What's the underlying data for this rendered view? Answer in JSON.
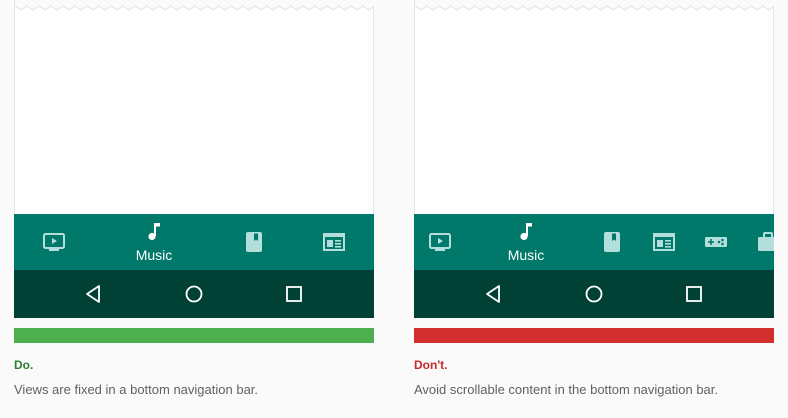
{
  "colors": {
    "nav_background": "#00796b",
    "system_bar": "#004035",
    "nav_icon_inactive": "#b2dfdb",
    "nav_icon_active": "#ffffff",
    "do_color": "#4caf50",
    "do_text_color": "#2e7d32",
    "dont_color": "#d32f2f",
    "dont_text_color": "#c62828"
  },
  "examples": [
    {
      "verdict": "Do.",
      "caption": "Views are fixed in a bottom navigation bar.",
      "active_label": "Music",
      "nav_icons": [
        "tv-icon",
        "music-note-icon",
        "book-icon",
        "newspaper-icon"
      ]
    },
    {
      "verdict": "Don't.",
      "caption": "Avoid scrollable content in the bottom navigation bar.",
      "active_label": "Music",
      "nav_icons": [
        "tv-icon",
        "music-note-icon",
        "book-icon",
        "newspaper-icon",
        "gamepad-icon",
        "briefcase-icon"
      ]
    }
  ],
  "system_nav_icons": [
    "back-icon",
    "home-icon",
    "recents-icon"
  ]
}
